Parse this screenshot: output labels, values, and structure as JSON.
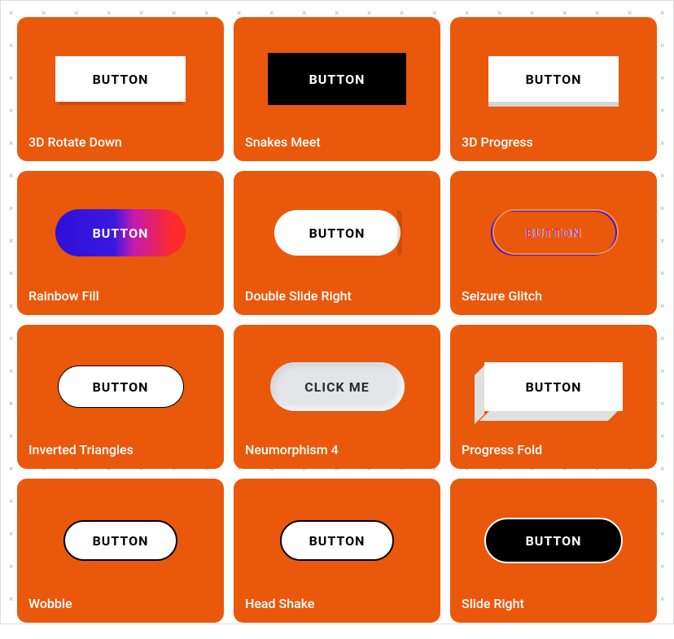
{
  "cards": [
    {
      "title": "3D Rotate Down",
      "button_label": "BUTTON",
      "style": "btn-rect-white"
    },
    {
      "title": "Snakes Meet",
      "button_label": "BUTTON",
      "style": "btn-rect-black"
    },
    {
      "title": "3D Progress",
      "button_label": "BUTTON",
      "style": "btn-rect-white shadow2"
    },
    {
      "title": "Rainbow Fill",
      "button_label": "BUTTON",
      "style": "btn-pill-rainbow"
    },
    {
      "title": "Double Slide Right",
      "button_label": "BUTTON",
      "style": "btn-pill-white"
    },
    {
      "title": "Seizure Glitch",
      "button_label": "BUTTON",
      "style": "btn-pill-glitch"
    },
    {
      "title": "Inverted Triangles",
      "button_label": "BUTTON",
      "style": "btn-pill-white-thin"
    },
    {
      "title": "Neumorphism 4",
      "button_label": "CLICK ME",
      "style": "btn-pill-neu"
    },
    {
      "title": "Progress Fold",
      "button_label": "BUTTON",
      "style": "btn-fold"
    },
    {
      "title": "Wobble",
      "button_label": "BUTTON",
      "style": "btn-pill-white-solid"
    },
    {
      "title": "Head Shake",
      "button_label": "BUTTON",
      "style": "btn-pill-white-solid"
    },
    {
      "title": "Slide Right",
      "button_label": "BUTTON",
      "style": "btn-pill-black"
    }
  ]
}
